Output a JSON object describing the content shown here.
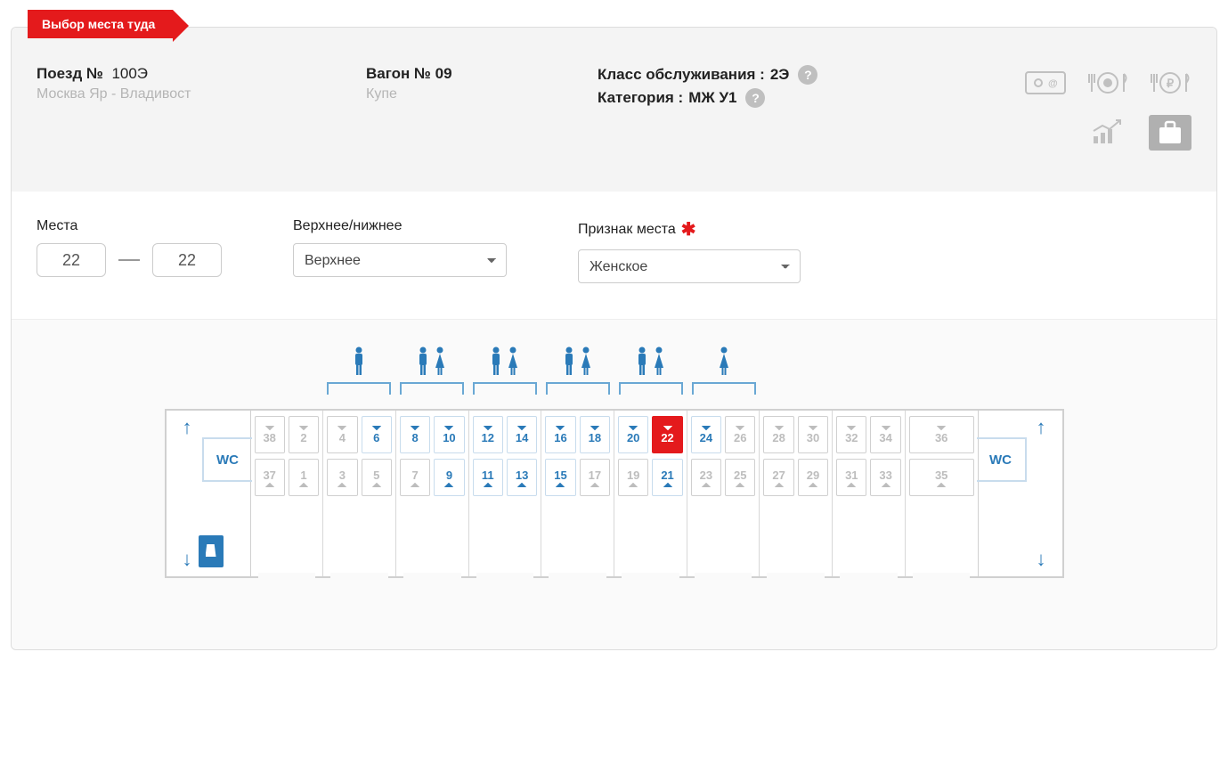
{
  "tab_title": "Выбор места туда",
  "train": {
    "label": "Поезд №",
    "number": "100Э",
    "route": "Москва Яр - Владивост"
  },
  "carriage": {
    "label": "Вагон № 09",
    "type": "Купе"
  },
  "service": {
    "class_label": "Класс обслуживания :",
    "class_value": "2Э",
    "cat_label": "Категория :",
    "cat_value": "МЖ У1",
    "help": "?"
  },
  "controls": {
    "seats_label": "Места",
    "seat_from": "22",
    "seat_to": "22",
    "berth_label": "Верхнее/нижнее",
    "berth_value": "Верхнее",
    "gender_label": "Признак места",
    "gender_value": "Женское"
  },
  "wc_label": "WC",
  "compartments": [
    {
      "gender": null,
      "top": [
        {
          "n": "38",
          "s": "occupied"
        },
        {
          "n": "2",
          "s": "occupied"
        }
      ],
      "bot": [
        {
          "n": "37",
          "s": "occupied"
        },
        {
          "n": "1",
          "s": "occupied"
        }
      ]
    },
    {
      "gender": "male",
      "top": [
        {
          "n": "4",
          "s": "occupied"
        },
        {
          "n": "6",
          "s": "available"
        }
      ],
      "bot": [
        {
          "n": "3",
          "s": "occupied"
        },
        {
          "n": "5",
          "s": "occupied"
        }
      ]
    },
    {
      "gender": "mixed",
      "top": [
        {
          "n": "8",
          "s": "available"
        },
        {
          "n": "10",
          "s": "available"
        }
      ],
      "bot": [
        {
          "n": "7",
          "s": "occupied"
        },
        {
          "n": "9",
          "s": "available"
        }
      ]
    },
    {
      "gender": "mixed",
      "top": [
        {
          "n": "12",
          "s": "available"
        },
        {
          "n": "14",
          "s": "available"
        }
      ],
      "bot": [
        {
          "n": "11",
          "s": "available"
        },
        {
          "n": "13",
          "s": "available"
        }
      ]
    },
    {
      "gender": "mixed",
      "top": [
        {
          "n": "16",
          "s": "available"
        },
        {
          "n": "18",
          "s": "available"
        }
      ],
      "bot": [
        {
          "n": "15",
          "s": "available"
        },
        {
          "n": "17",
          "s": "occupied"
        }
      ]
    },
    {
      "gender": "mixed",
      "top": [
        {
          "n": "20",
          "s": "available"
        },
        {
          "n": "22",
          "s": "selected"
        }
      ],
      "bot": [
        {
          "n": "19",
          "s": "occupied"
        },
        {
          "n": "21",
          "s": "available"
        }
      ]
    },
    {
      "gender": "female",
      "top": [
        {
          "n": "24",
          "s": "available"
        },
        {
          "n": "26",
          "s": "occupied"
        }
      ],
      "bot": [
        {
          "n": "23",
          "s": "occupied"
        },
        {
          "n": "25",
          "s": "occupied"
        }
      ]
    },
    {
      "gender": null,
      "top": [
        {
          "n": "28",
          "s": "occupied"
        },
        {
          "n": "30",
          "s": "occupied"
        }
      ],
      "bot": [
        {
          "n": "27",
          "s": "occupied"
        },
        {
          "n": "29",
          "s": "occupied"
        }
      ]
    },
    {
      "gender": null,
      "top": [
        {
          "n": "32",
          "s": "occupied"
        },
        {
          "n": "34",
          "s": "occupied"
        }
      ],
      "bot": [
        {
          "n": "31",
          "s": "occupied"
        },
        {
          "n": "33",
          "s": "occupied"
        }
      ]
    },
    {
      "gender": null,
      "top": [
        {
          "n": "36",
          "s": "occupied"
        }
      ],
      "bot": [
        {
          "n": "35",
          "s": "occupied"
        }
      ]
    }
  ]
}
